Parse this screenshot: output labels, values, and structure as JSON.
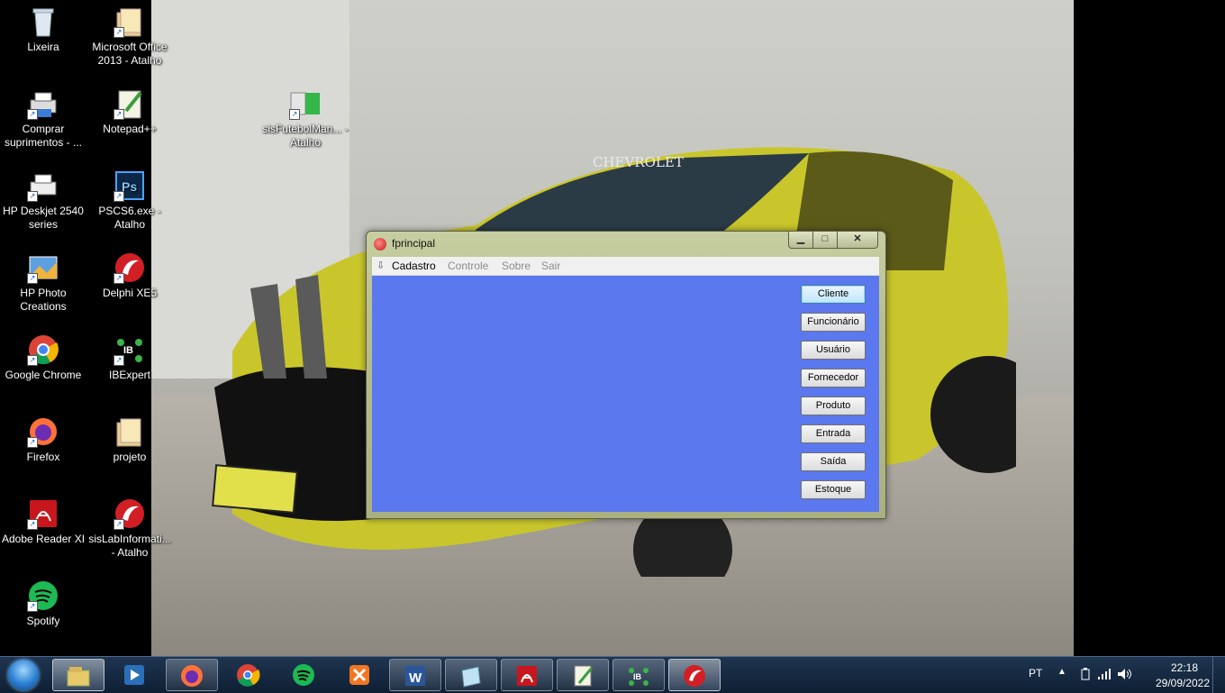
{
  "desktop": {
    "icons": [
      {
        "name": "recycle-bin",
        "label": "Lixeira",
        "icon": "recycle-bin-icon"
      },
      {
        "name": "ms-office",
        "label": "Microsoft Office 2013 - Atalho",
        "icon": "folder-icon"
      },
      {
        "name": "comprar-suprimentos",
        "label": "Comprar suprimentos - ...",
        "icon": "printer-icon"
      },
      {
        "name": "notepad-plus",
        "label": "Notepad++",
        "icon": "notepad-icon"
      },
      {
        "name": "sisfutebol",
        "label": "sisFutebolMan... - Atalho",
        "icon": "app-icon"
      },
      {
        "name": "hp-deskjet",
        "label": "HP Deskjet 2540 series",
        "icon": "printer-icon"
      },
      {
        "name": "pscs6",
        "label": "PSCS6.exe - Atalho",
        "icon": "photoshop-icon"
      },
      {
        "name": "hp-photo",
        "label": "HP Photo Creations",
        "icon": "photo-icon"
      },
      {
        "name": "delphi",
        "label": "Delphi XE5",
        "icon": "delphi-icon"
      },
      {
        "name": "chrome",
        "label": "Google Chrome",
        "icon": "chrome-icon"
      },
      {
        "name": "ibexpert",
        "label": "IBExpert",
        "icon": "ibexpert-icon"
      },
      {
        "name": "firefox",
        "label": "Firefox",
        "icon": "firefox-icon"
      },
      {
        "name": "projeto",
        "label": "projeto",
        "icon": "folder-icon"
      },
      {
        "name": "adobe-reader",
        "label": "Adobe Reader XI",
        "icon": "adobe-icon"
      },
      {
        "name": "sislab",
        "label": "sisLabInformati... - Atalho",
        "icon": "delphi-icon"
      },
      {
        "name": "spotify",
        "label": "Spotify",
        "icon": "spotify-icon"
      }
    ],
    "wallpaper_text": "CHEVROLET"
  },
  "window": {
    "title": "fprincipal",
    "min_glyph": "▁",
    "max_glyph": "□",
    "close_glyph": "✕",
    "menu": {
      "handle": "⇩",
      "items": [
        {
          "label": "Cadastro",
          "enabled": true
        },
        {
          "label": "Controle",
          "enabled": false
        },
        {
          "label": "Sobre",
          "enabled": false
        },
        {
          "label": "Sair",
          "enabled": false
        }
      ]
    },
    "buttons": [
      "Cliente",
      "Funcionário",
      "Usuário",
      "Fornecedor",
      "Produto",
      "Entrada",
      "Saída",
      "Estoque"
    ],
    "client_color": "#5b78ee"
  },
  "taskbar": {
    "apps": [
      {
        "name": "explorer",
        "icon": "explorer-icon"
      },
      {
        "name": "media",
        "icon": "media-icon"
      },
      {
        "name": "firefox",
        "icon": "firefox-icon"
      },
      {
        "name": "chrome",
        "icon": "chrome-icon"
      },
      {
        "name": "spotify",
        "icon": "spotify-icon"
      },
      {
        "name": "xampp",
        "icon": "xampp-icon"
      },
      {
        "name": "word",
        "icon": "word-icon"
      },
      {
        "name": "notepad",
        "icon": "notepad-icon"
      },
      {
        "name": "adobe",
        "icon": "adobe-icon"
      },
      {
        "name": "notepadpp",
        "icon": "notepadpp-icon"
      },
      {
        "name": "ibexpert",
        "icon": "ibexpert-icon"
      },
      {
        "name": "delphi",
        "icon": "delphi-icon"
      }
    ],
    "tray": {
      "lang": "PT",
      "arrow": "▲",
      "time": "22:18",
      "date": "29/09/2022"
    }
  }
}
